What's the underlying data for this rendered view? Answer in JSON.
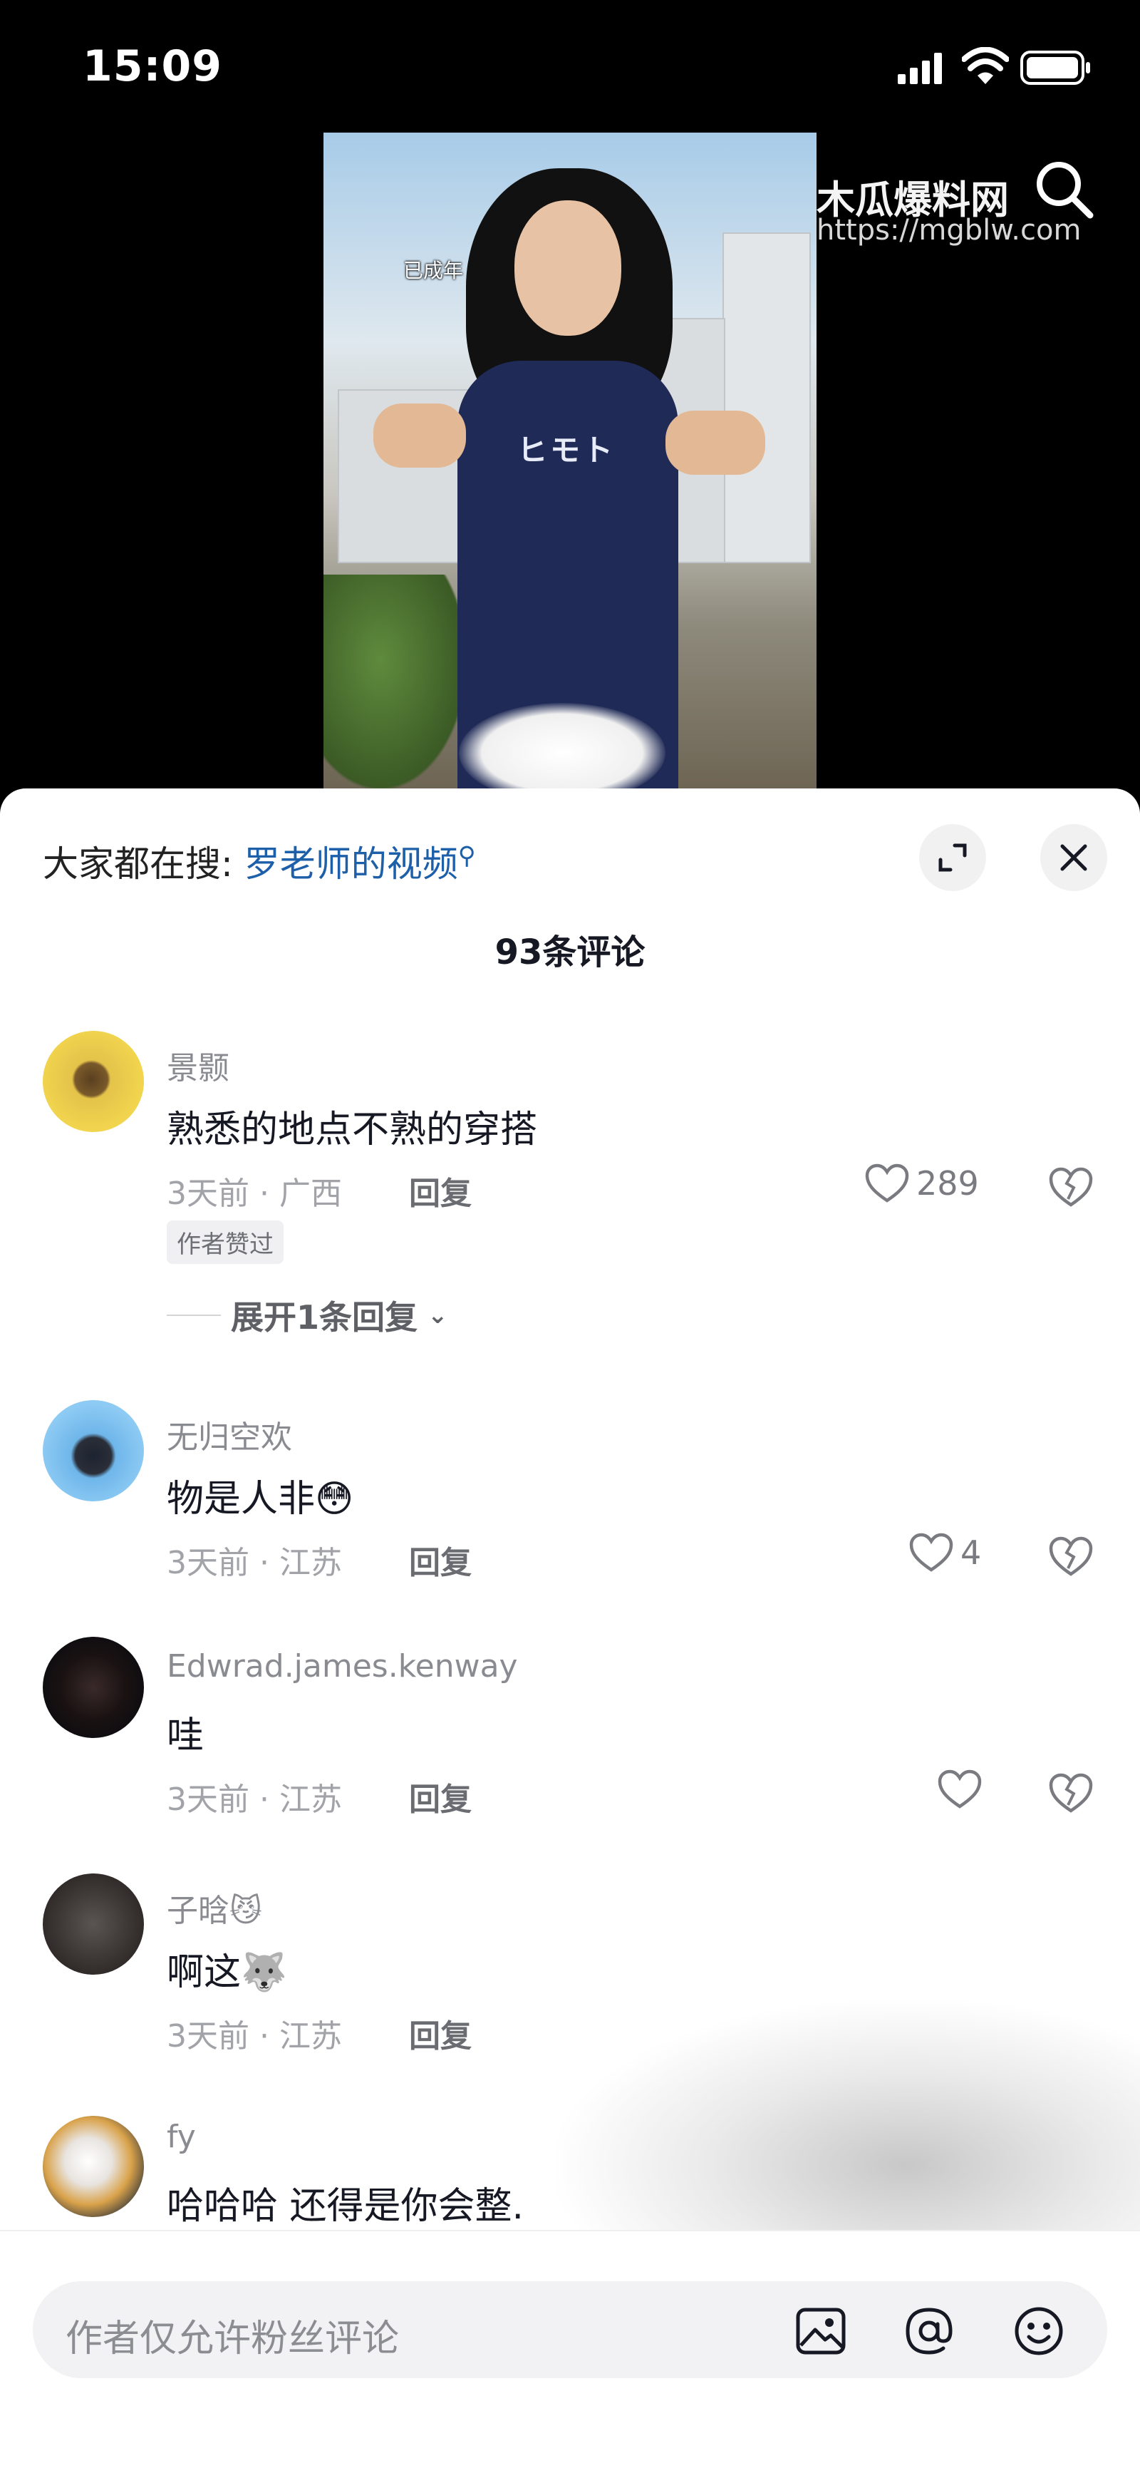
{
  "status_bar": {
    "time": "15:09"
  },
  "video": {
    "overlay_tag": "已成年",
    "shirt_text": "ヒモト"
  },
  "watermark": {
    "title": "木瓜爆料网",
    "url": "https://mgblw.com"
  },
  "sheet": {
    "search_prefix": "大家都在搜:",
    "search_keyword": "罗老师的视频",
    "comment_count": "93条评论"
  },
  "comments": [
    {
      "username": "景颢",
      "text": "熟悉的地点不熟的穿搭",
      "meta": "3天前 · 广西",
      "reply": "回复",
      "likes": "289",
      "badge": "作者赞过",
      "expand": "展开1条回复"
    },
    {
      "username": "无归空欢",
      "text": "物是人非😳",
      "meta": "3天前 · 江苏",
      "reply": "回复",
      "likes": "4"
    },
    {
      "username": "Edwrad.james.kenway",
      "text": "哇",
      "meta": "3天前 · 江苏",
      "reply": "回复",
      "likes": ""
    },
    {
      "username": "子晗😼",
      "text": "啊这🐺",
      "meta": "3天前 · 江苏",
      "reply": "回复",
      "likes": ""
    },
    {
      "username": "fy",
      "text": "哈哈哈 还得是你会整.",
      "meta": "",
      "reply": "",
      "likes": ""
    }
  ],
  "input": {
    "placeholder": "作者仅允许粉丝评论"
  },
  "colors": {
    "link": "#1d5fa8",
    "background": "#ffffff"
  }
}
